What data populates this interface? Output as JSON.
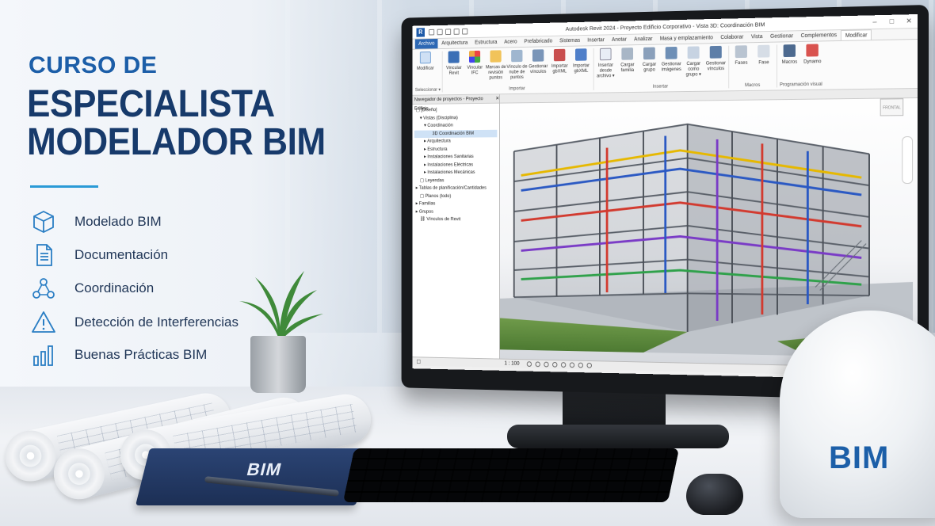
{
  "course": {
    "pre_title": "CURSO DE",
    "title_line1": "ESPECIALISTA",
    "title_line2": "MODELADOR BIM",
    "features": [
      {
        "icon": "cube-icon",
        "label": "Modelado BIM"
      },
      {
        "icon": "document-icon",
        "label": "Documentación"
      },
      {
        "icon": "network-icon",
        "label": "Coordinación"
      },
      {
        "icon": "warning-icon",
        "label": "Detección de Interferencias"
      },
      {
        "icon": "bar-chart-icon",
        "label": "Buenas Prácticas BIM"
      }
    ]
  },
  "props": {
    "notebook_label": "BIM",
    "helmet_label": "BIM"
  },
  "revit": {
    "window_title": "Autodesk Revit 2024 - Proyecto Edificio Corporativo - Vista 3D: Coordinación BIM",
    "app_logo": "R",
    "tabs": [
      "Archivo",
      "Arquitectura",
      "Estructura",
      "Acero",
      "Prefabricado",
      "Sistemas",
      "Insertar",
      "Anotar",
      "Analizar",
      "Masa y emplazamiento",
      "Colaborar",
      "Vista",
      "Gestionar",
      "Complementos",
      "Modificar"
    ],
    "ribbon": {
      "select_group": {
        "button": "Modificar",
        "label": "Seleccionar ▾"
      },
      "import_group": {
        "buttons": [
          "Vincular Revit",
          "Vincular IFC",
          "Marcas de revisión puntos",
          "Vínculo de nube de puntos",
          "Gestionar vínculos",
          "Importar gbXML",
          "Importar gbXML"
        ],
        "label": "Importar"
      },
      "insert_group": {
        "buttons": [
          "Insertar desde archivo ▾",
          "Cargar familia",
          "Cargar grupo",
          "Gestionar imágenes",
          "Cargar como grupo ▾",
          "Gestionar vínculos"
        ],
        "label": "Insertar"
      },
      "macros_group": {
        "buttons": [
          "Fases",
          "Fase"
        ],
        "label": "Macros"
      },
      "visual_group": {
        "buttons": [
          "Macros",
          "Dynamo"
        ],
        "label": "Programación visual"
      }
    },
    "browser": {
      "header": "Navegador de proyectos - Proyecto Edificio",
      "items": [
        {
          "label": "[Diseño]",
          "level": 0
        },
        {
          "label": "Vistas (Disciplina)",
          "level": 1
        },
        {
          "label": "Coordinación",
          "level": 2
        },
        {
          "label": "3D Coordinación BIM",
          "level": 3,
          "selected": true
        },
        {
          "label": "Arquitectura",
          "level": 2
        },
        {
          "label": "Estructura",
          "level": 2
        },
        {
          "label": "Instalaciones Sanitarias",
          "level": 2
        },
        {
          "label": "Instalaciones Eléctricas",
          "level": 2
        },
        {
          "label": "Instalaciones Mecánicas",
          "level": 2
        },
        {
          "label": "Leyendas",
          "level": 1
        },
        {
          "label": "Tablas de planificación/Cantidades",
          "level": 1
        },
        {
          "label": "Planos (todo)",
          "level": 1
        },
        {
          "label": "Familias",
          "level": 1
        },
        {
          "label": "Grupos",
          "level": 1
        },
        {
          "label": "Vínculos de Revit",
          "level": 1
        }
      ]
    },
    "viewcube_label": "FRONTAL",
    "status": {
      "scale": "1 : 100"
    }
  }
}
